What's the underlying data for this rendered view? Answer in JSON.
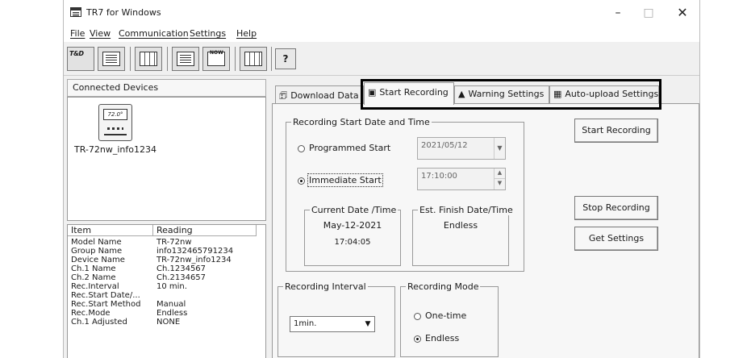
{
  "window": {
    "title": "TR7 for Windows",
    "min": "–",
    "max": "□",
    "close": "✕"
  },
  "menu": [
    "File",
    "View",
    "Communication",
    "Settings",
    "Help"
  ],
  "toolbar": {
    "help": "?"
  },
  "left": {
    "header": "Connected Devices",
    "device_screen": "72.0°",
    "device_name": "TR-72nw_info1234",
    "info_headers": [
      "Item",
      "Reading"
    ],
    "info_rows": [
      [
        "Model Name",
        "TR-72nw"
      ],
      [
        "Group Name",
        "info132465791234"
      ],
      [
        "Device Name",
        "TR-72nw_info1234"
      ],
      [
        "Ch.1 Name",
        "Ch.1234567"
      ],
      [
        "Ch.2 Name",
        "Ch.2134657"
      ],
      [
        "Rec.Interval",
        "10 min."
      ],
      [
        "Rec.Start Date/...",
        ""
      ],
      [
        "Rec.Start Method",
        "Manual"
      ],
      [
        "Rec.Mode",
        "Endless"
      ],
      [
        "Ch.1 Adjusted",
        "NONE"
      ]
    ]
  },
  "tabs": [
    {
      "label": "Download Data",
      "icon": "download-icon"
    },
    {
      "label": "Start Recording",
      "icon": "recorder-icon"
    },
    {
      "label": "Warning Settings",
      "icon": "warning-icon"
    },
    {
      "label": "Auto-upload Settings",
      "icon": "network-icon"
    }
  ],
  "start_recording": {
    "group_title": "Recording Start Date and Time",
    "programmed_label": "Programmed Start",
    "programmed_date": "2021/05/12",
    "immediate_label": "Immediate Start",
    "immediate_time": "17:10:00",
    "selected_start": "Immediate Start",
    "current_title": "Current Date /Time",
    "current_date": "May-12-2021",
    "current_time": "17:04:05",
    "finish_title": "Est. Finish Date/Time",
    "finish_value": "Endless",
    "interval_title": "Recording Interval",
    "interval_value": "1min.",
    "mode_title": "Recording Mode",
    "mode_onetime": "One-time",
    "mode_endless": "Endless",
    "selected_mode": "Endless",
    "btn_start": "Start Recording",
    "btn_stop": "Stop Recording",
    "btn_get": "Get Settings"
  }
}
